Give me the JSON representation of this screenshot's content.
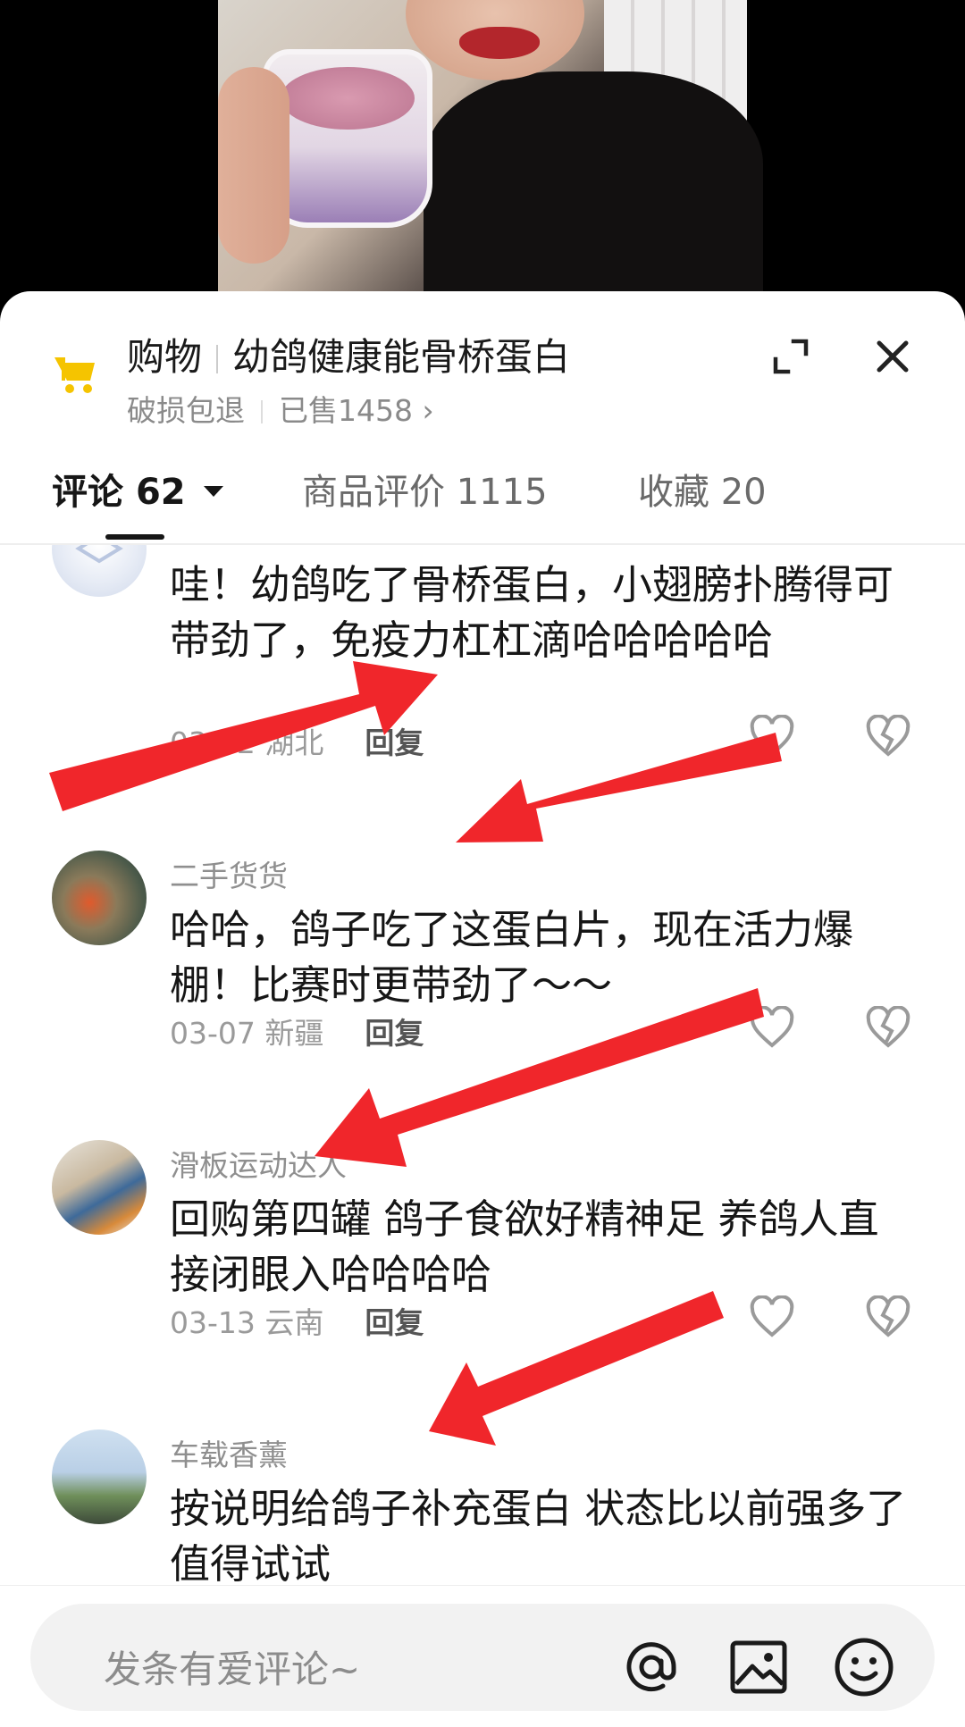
{
  "product": {
    "category": "购物",
    "name": "幼鸽健康能骨桥蛋白",
    "tag": "破损包退",
    "sold": "已售1458",
    "chevron": "›",
    "accent_color": "#F5C400"
  },
  "tabs": [
    {
      "label": "评论",
      "count": "62",
      "active": true
    },
    {
      "label": "商品评价",
      "count": "1115",
      "active": false
    },
    {
      "label": "收藏",
      "count": "20",
      "active": false
    }
  ],
  "comments": [
    {
      "user": "",
      "text": "哇！幼鸽吃了骨桥蛋白，小翅膀扑腾得可带劲了，免疫力杠杠滴哈哈哈哈哈",
      "date": "03-12",
      "region": "湖北",
      "reply": "回复"
    },
    {
      "user": "二手货货",
      "text": "哈哈，鸽子吃了这蛋白片，现在活力爆棚！比赛时更带劲了～～",
      "date": "03-07",
      "region": "新疆",
      "reply": "回复"
    },
    {
      "user": "滑板运动达人",
      "text": "回购第四罐 鸽子食欲好精神足 养鸽人直接闭眼入哈哈哈哈",
      "date": "03-13",
      "region": "云南",
      "reply": "回复"
    },
    {
      "user": "车载香薰",
      "text": "按说明给鸽子补充蛋白 状态比以前强多了 值得试试",
      "date": "",
      "region": "",
      "reply": ""
    }
  ],
  "input": {
    "placeholder": "发条有爱评论~"
  },
  "annotation_color": "#F0262B"
}
